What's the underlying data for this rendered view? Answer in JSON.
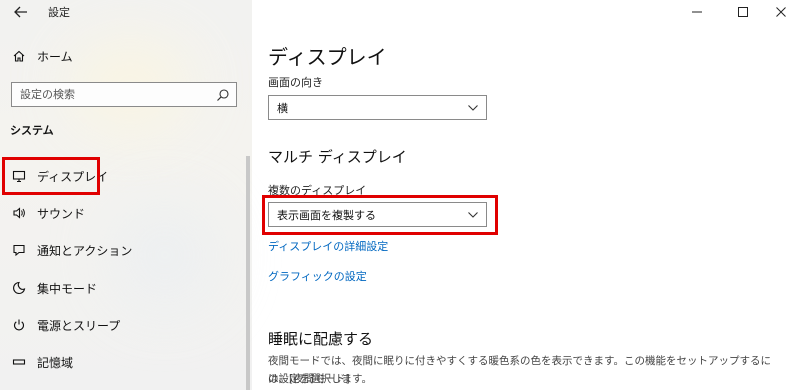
{
  "window": {
    "title": "設定",
    "back_icon": "arrow-left-icon",
    "controls": {
      "minimize": "—",
      "maximize": "☐",
      "close": "✕"
    }
  },
  "sidebar": {
    "home": {
      "label": "ホーム",
      "icon": "home-icon"
    },
    "search": {
      "placeholder": "設定の検索",
      "icon": "search-icon"
    },
    "section": "システム",
    "items": [
      {
        "label": "ディスプレイ",
        "icon": "monitor-icon",
        "selected": true
      },
      {
        "label": "サウンド",
        "icon": "speaker-icon"
      },
      {
        "label": "通知とアクション",
        "icon": "notification-icon"
      },
      {
        "label": "集中モード",
        "icon": "moon-icon"
      },
      {
        "label": "電源とスリープ",
        "icon": "power-icon"
      },
      {
        "label": "記憶域",
        "icon": "storage-icon"
      }
    ]
  },
  "main": {
    "title": "ディスプレイ",
    "orientation": {
      "label": "画面の向き",
      "value": "横"
    },
    "multi_display": {
      "title": "マルチ ディスプレイ",
      "label": "複数のディスプレイ",
      "value": "表示画面を複製する",
      "advanced_link": "ディスプレイの詳細設定",
      "graphics_link": "グラフィックの設定"
    },
    "sleep": {
      "title": "睡眠に配慮する",
      "description_line1": "夜間モードでは、夜間に眠りに付きやすくする暖色系の色を表示できます。この機能をセットアップするには、[夜間モード]",
      "description_line2": "の設定を選択します。"
    }
  },
  "colors": {
    "accent_link": "#0067c0",
    "highlight": "#e00000",
    "sidebar_bg": "#f2f2f0"
  }
}
